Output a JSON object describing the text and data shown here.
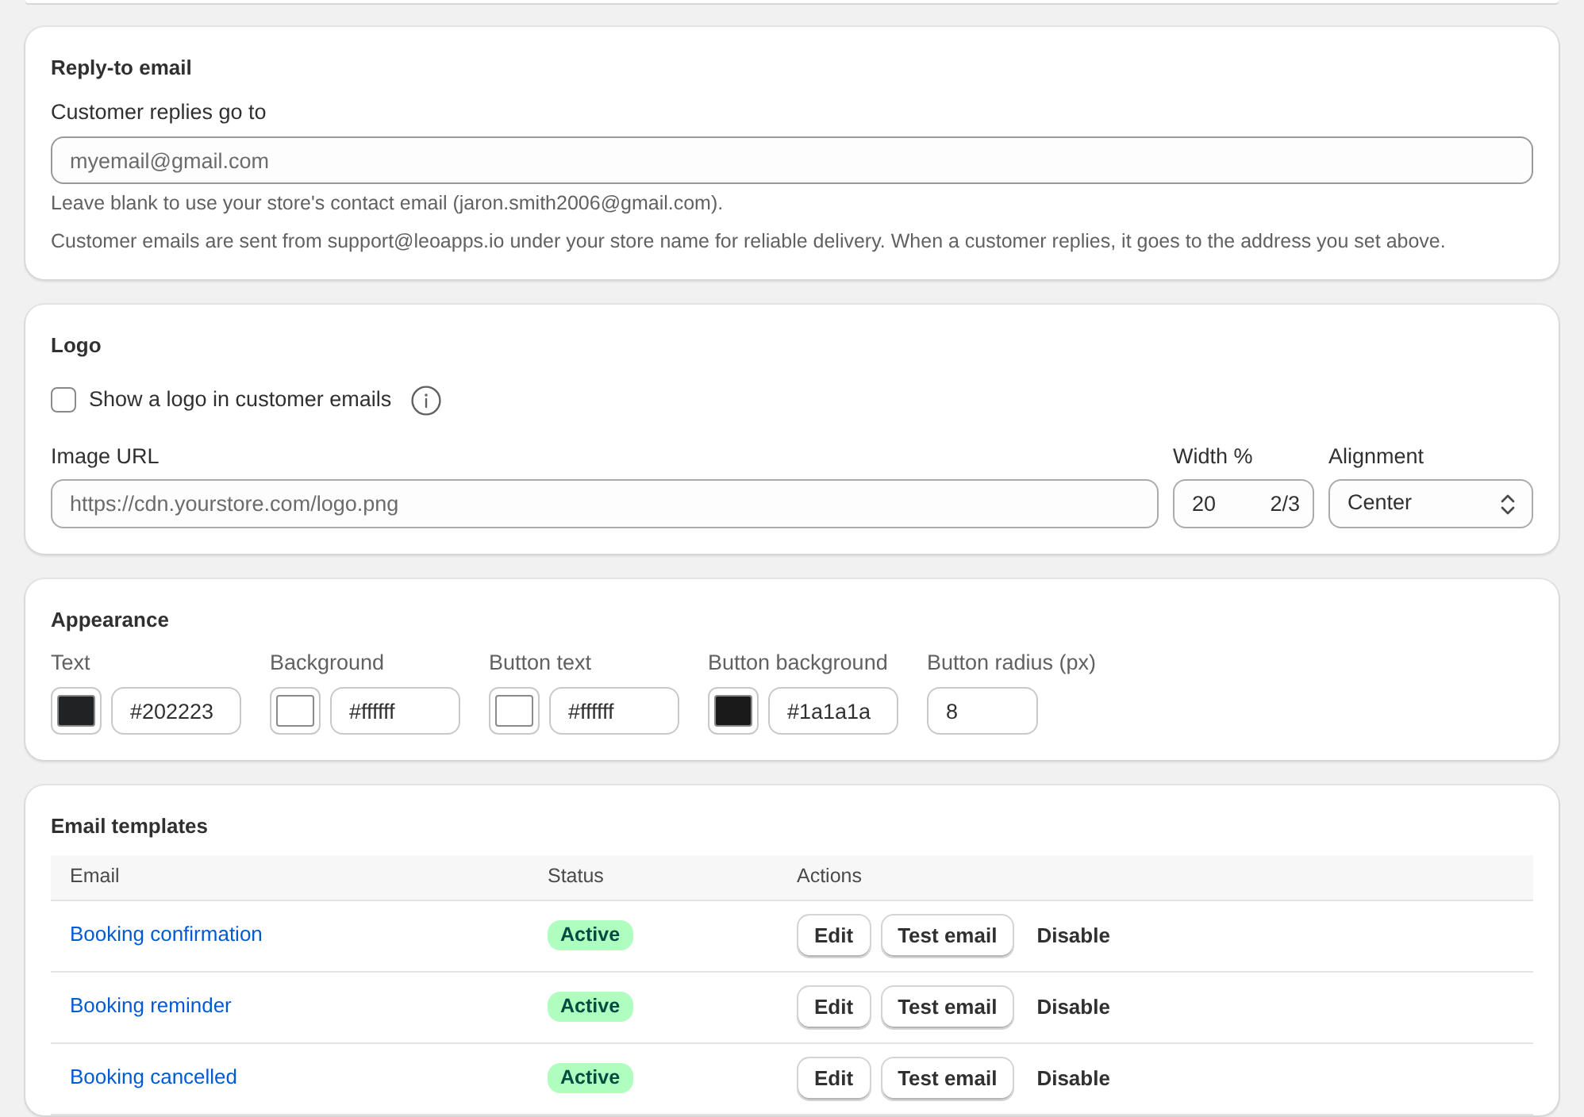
{
  "reply_to": {
    "title": "Reply-to email",
    "label": "Customer replies go to",
    "placeholder": "myemail@gmail.com",
    "help": [
      "Leave blank to use your store's contact email (jaron.smith2006@gmail.com).",
      "Customer emails are sent from support@leoapps.io under your store name for reliable delivery. When a customer replies, it goes to the address you set above."
    ]
  },
  "logo": {
    "title": "Logo",
    "show_logo": {
      "label": "Show a logo in customer emails",
      "checked": false
    },
    "image_url": {
      "label": "Image URL",
      "placeholder": "https://cdn.yourstore.com/logo.png"
    },
    "width": {
      "label": "Width %",
      "value": "20",
      "suffix": "2/3"
    },
    "alignment": {
      "label": "Alignment",
      "value": "Center"
    }
  },
  "appearance": {
    "title": "Appearance",
    "colors": [
      {
        "label": "Text",
        "color": "#202223",
        "value": "#202223"
      },
      {
        "label": "Background",
        "color": "#ffffff",
        "value": "#ffffff"
      },
      {
        "label": "Button text",
        "color": "#ffffff",
        "value": "#ffffff"
      },
      {
        "label": "Button background",
        "color": "#1a1a1a",
        "value": "#1a1a1a"
      }
    ],
    "radius": {
      "label": "Button radius (px)",
      "value": "8"
    }
  },
  "templates": {
    "title": "Email templates",
    "columns": [
      "Email",
      "Status",
      "Actions"
    ],
    "rows": [
      {
        "email": "Booking confirmation",
        "status": "Active",
        "actions": [
          {
            "label": "Edit",
            "kind": "button"
          },
          {
            "label": "Test email",
            "kind": "button"
          },
          {
            "label": "Disable",
            "kind": "plain"
          }
        ]
      },
      {
        "email": "Booking reminder",
        "status": "Active",
        "actions": [
          {
            "label": "Edit",
            "kind": "button"
          },
          {
            "label": "Test email",
            "kind": "button"
          },
          {
            "label": "Disable",
            "kind": "plain"
          }
        ]
      },
      {
        "email": "Booking cancelled",
        "status": "Active",
        "actions": [
          {
            "label": "Edit",
            "kind": "button"
          },
          {
            "label": "Test email",
            "kind": "button"
          },
          {
            "label": "Disable",
            "kind": "plain"
          }
        ]
      }
    ]
  }
}
